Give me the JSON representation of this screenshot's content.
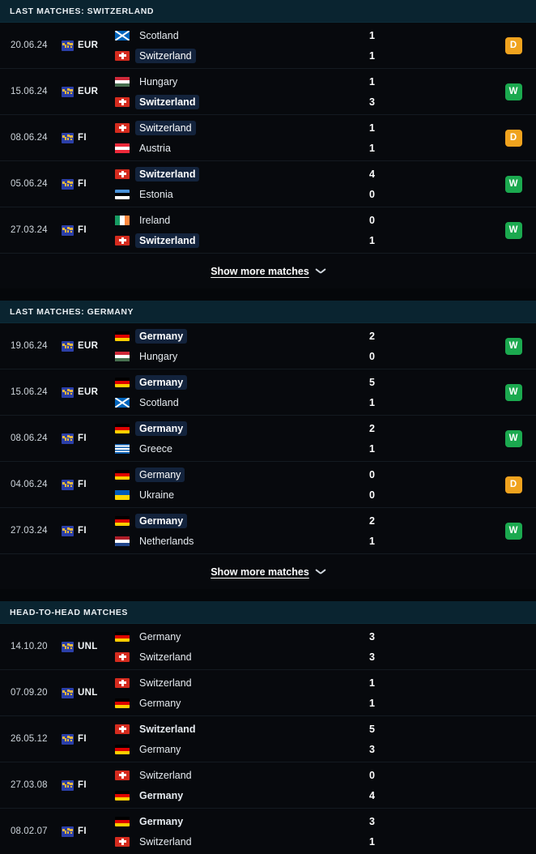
{
  "colors": {
    "page_bg": "#05070a",
    "row_bg": "#07090d",
    "section_header_bg": "#0a2430",
    "highlight_pill": "#13233c",
    "win": "#1ba94f",
    "draw": "#f0a31e",
    "loss": "#e0403c"
  },
  "sections": [
    {
      "id": "last-matches-switzerland",
      "title": "LAST MATCHES: SWITZERLAND",
      "show_more_label": "Show more matches",
      "has_result_badges": true,
      "matches": [
        {
          "date": "20.06.24",
          "competition": "EUR",
          "competition_icon": "world-map-icon",
          "home": {
            "team": "Scotland",
            "flag": "sc",
            "highlight": false,
            "bold": false
          },
          "away": {
            "team": "Switzerland",
            "flag": "ch",
            "highlight": true,
            "bold": false
          },
          "home_score": "1",
          "away_score": "1",
          "result": "D"
        },
        {
          "date": "15.06.24",
          "competition": "EUR",
          "competition_icon": "world-map-icon",
          "home": {
            "team": "Hungary",
            "flag": "hu",
            "highlight": false,
            "bold": false
          },
          "away": {
            "team": "Switzerland",
            "flag": "ch",
            "highlight": true,
            "bold": true
          },
          "home_score": "1",
          "away_score": "3",
          "result": "W"
        },
        {
          "date": "08.06.24",
          "competition": "FI",
          "competition_icon": "world-map-icon",
          "home": {
            "team": "Switzerland",
            "flag": "ch",
            "highlight": true,
            "bold": false
          },
          "away": {
            "team": "Austria",
            "flag": "at",
            "highlight": false,
            "bold": false
          },
          "home_score": "1",
          "away_score": "1",
          "result": "D"
        },
        {
          "date": "05.06.24",
          "competition": "FI",
          "competition_icon": "world-map-icon",
          "home": {
            "team": "Switzerland",
            "flag": "ch",
            "highlight": true,
            "bold": true
          },
          "away": {
            "team": "Estonia",
            "flag": "ee",
            "highlight": false,
            "bold": false
          },
          "home_score": "4",
          "away_score": "0",
          "result": "W"
        },
        {
          "date": "27.03.24",
          "competition": "FI",
          "competition_icon": "world-map-icon",
          "home": {
            "team": "Ireland",
            "flag": "ie",
            "highlight": false,
            "bold": false
          },
          "away": {
            "team": "Switzerland",
            "flag": "ch",
            "highlight": true,
            "bold": true
          },
          "home_score": "0",
          "away_score": "1",
          "result": "W"
        }
      ]
    },
    {
      "id": "last-matches-germany",
      "title": "LAST MATCHES: GERMANY",
      "show_more_label": "Show more matches",
      "has_result_badges": true,
      "matches": [
        {
          "date": "19.06.24",
          "competition": "EUR",
          "competition_icon": "world-map-icon",
          "home": {
            "team": "Germany",
            "flag": "de",
            "highlight": true,
            "bold": true
          },
          "away": {
            "team": "Hungary",
            "flag": "hu",
            "highlight": false,
            "bold": false
          },
          "home_score": "2",
          "away_score": "0",
          "result": "W"
        },
        {
          "date": "15.06.24",
          "competition": "EUR",
          "competition_icon": "world-map-icon",
          "home": {
            "team": "Germany",
            "flag": "de",
            "highlight": true,
            "bold": true
          },
          "away": {
            "team": "Scotland",
            "flag": "sc",
            "highlight": false,
            "bold": false
          },
          "home_score": "5",
          "away_score": "1",
          "result": "W"
        },
        {
          "date": "08.06.24",
          "competition": "FI",
          "competition_icon": "world-map-icon",
          "home": {
            "team": "Germany",
            "flag": "de",
            "highlight": true,
            "bold": true
          },
          "away": {
            "team": "Greece",
            "flag": "gr",
            "highlight": false,
            "bold": false
          },
          "home_score": "2",
          "away_score": "1",
          "result": "W"
        },
        {
          "date": "04.06.24",
          "competition": "FI",
          "competition_icon": "world-map-icon",
          "home": {
            "team": "Germany",
            "flag": "de",
            "highlight": true,
            "bold": false
          },
          "away": {
            "team": "Ukraine",
            "flag": "ua",
            "highlight": false,
            "bold": false
          },
          "home_score": "0",
          "away_score": "0",
          "result": "D"
        },
        {
          "date": "27.03.24",
          "competition": "FI",
          "competition_icon": "world-map-icon",
          "home": {
            "team": "Germany",
            "flag": "de",
            "highlight": true,
            "bold": true
          },
          "away": {
            "team": "Netherlands",
            "flag": "nl",
            "highlight": false,
            "bold": false
          },
          "home_score": "2",
          "away_score": "1",
          "result": "W"
        }
      ]
    },
    {
      "id": "head-to-head-matches",
      "title": "HEAD-TO-HEAD MATCHES",
      "show_more_label": "",
      "has_result_badges": false,
      "matches": [
        {
          "date": "14.10.20",
          "competition": "UNL",
          "competition_icon": "world-map-icon",
          "home": {
            "team": "Germany",
            "flag": "de",
            "highlight": false,
            "bold": false
          },
          "away": {
            "team": "Switzerland",
            "flag": "ch",
            "highlight": false,
            "bold": false
          },
          "home_score": "3",
          "away_score": "3",
          "result": ""
        },
        {
          "date": "07.09.20",
          "competition": "UNL",
          "competition_icon": "world-map-icon",
          "home": {
            "team": "Switzerland",
            "flag": "ch",
            "highlight": false,
            "bold": false
          },
          "away": {
            "team": "Germany",
            "flag": "de",
            "highlight": false,
            "bold": false
          },
          "home_score": "1",
          "away_score": "1",
          "result": ""
        },
        {
          "date": "26.05.12",
          "competition": "FI",
          "competition_icon": "world-map-icon",
          "home": {
            "team": "Switzerland",
            "flag": "ch",
            "highlight": false,
            "bold": true
          },
          "away": {
            "team": "Germany",
            "flag": "de",
            "highlight": false,
            "bold": false
          },
          "home_score": "5",
          "away_score": "3",
          "result": ""
        },
        {
          "date": "27.03.08",
          "competition": "FI",
          "competition_icon": "world-map-icon",
          "home": {
            "team": "Switzerland",
            "flag": "ch",
            "highlight": false,
            "bold": false
          },
          "away": {
            "team": "Germany",
            "flag": "de",
            "highlight": false,
            "bold": true
          },
          "home_score": "0",
          "away_score": "4",
          "result": ""
        },
        {
          "date": "08.02.07",
          "competition": "FI",
          "competition_icon": "world-map-icon",
          "home": {
            "team": "Germany",
            "flag": "de",
            "highlight": false,
            "bold": true
          },
          "away": {
            "team": "Switzerland",
            "flag": "ch",
            "highlight": false,
            "bold": false
          },
          "home_score": "3",
          "away_score": "1",
          "result": ""
        }
      ]
    }
  ]
}
